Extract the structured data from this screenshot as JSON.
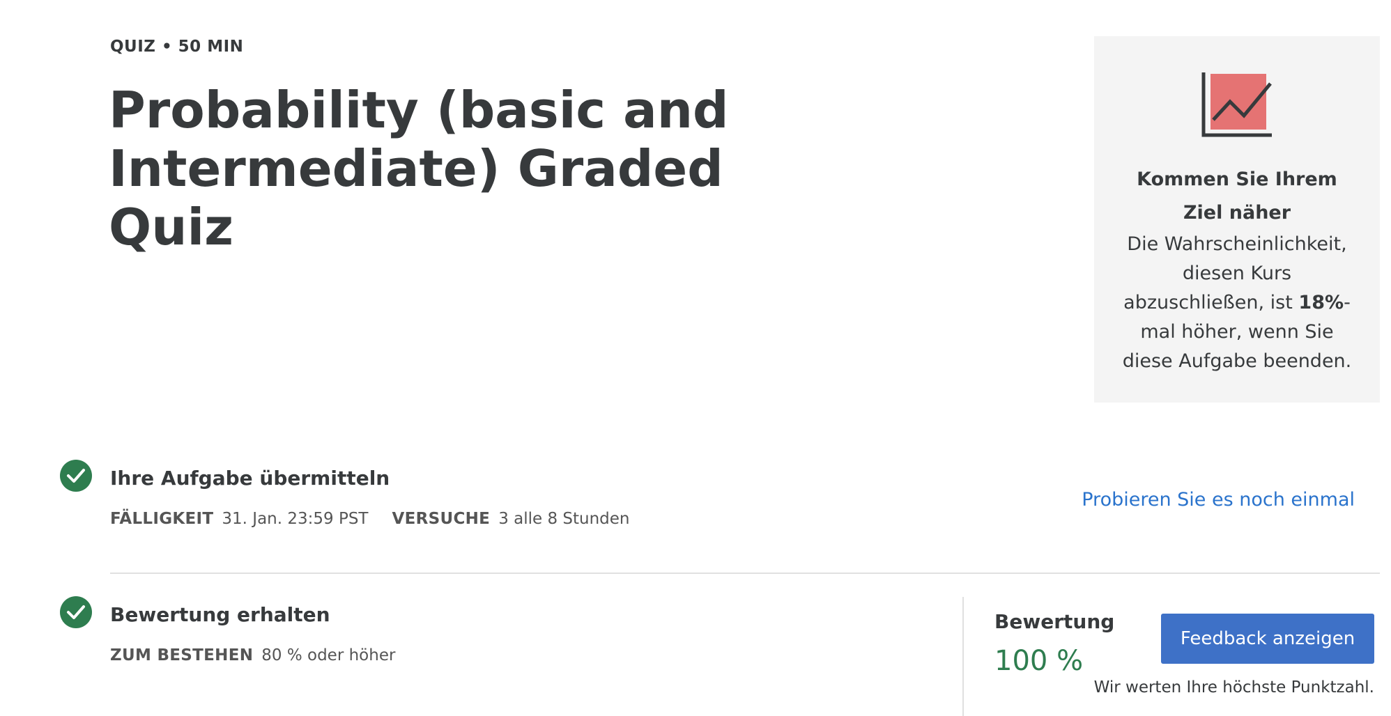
{
  "header": {
    "eyebrow": "QUIZ • 50 MIN",
    "title": "Probability (basic and Intermediate) Graded Quiz"
  },
  "goal_panel": {
    "icon": "trending-chart-icon",
    "heading": "Kommen Sie Ihrem Ziel näher",
    "text_before": "Die Wahrscheinlichkeit, diesen Kurs abzuschließen, ist ",
    "text_highlight": "18%",
    "text_after": "-mal höher, wenn Sie diese Aufgabe beenden.",
    "icon_color": "#e57373"
  },
  "submit_step": {
    "icon": "check-icon",
    "title": "Ihre Aufgabe übermitteln",
    "due_label": "FÄLLIGKEIT",
    "due_value": "31. Jan. 23:59 PST",
    "attempts_label": "VERSUCHE",
    "attempts_value": "3 alle 8 Stunden",
    "retry_link": "Probieren Sie es noch einmal"
  },
  "grade_step": {
    "icon": "check-icon",
    "title": "Bewertung erhalten",
    "pass_label": "ZUM BESTEHEN",
    "pass_value": "80 % oder höher",
    "grade_label": "Bewertung",
    "grade_value": "100 %",
    "feedback_button": "Feedback anzeigen",
    "grade_note": "Wir werten Ihre höchste Punktzahl."
  },
  "colors": {
    "accent_green": "#2e7d4f",
    "link_blue": "#2a73cc",
    "button_blue": "#3e71c7",
    "panel_bg": "#f4f4f4"
  }
}
